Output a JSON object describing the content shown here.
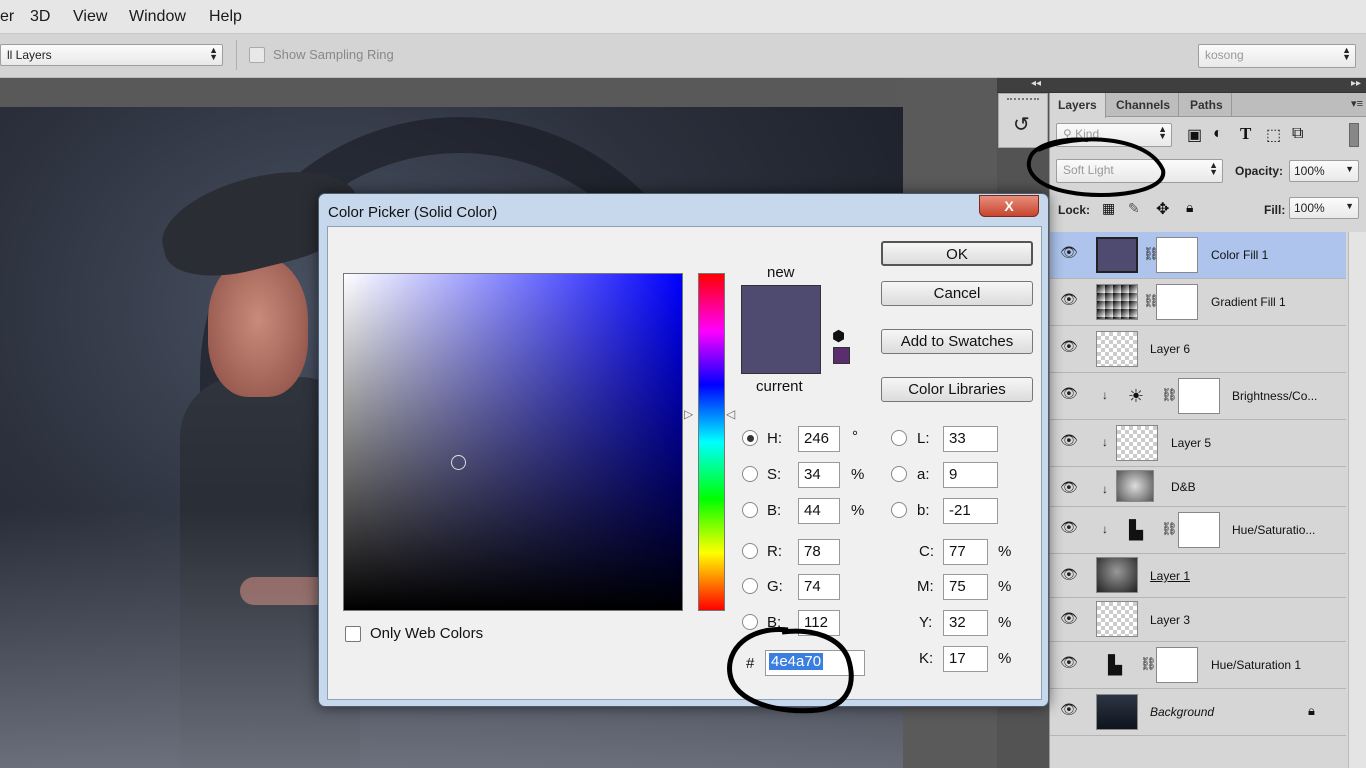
{
  "menu": {
    "items": [
      "er",
      "3D",
      "View",
      "Window",
      "Help"
    ]
  },
  "options": {
    "sample_select": "ll Layers",
    "sampling_ring_label": "Show Sampling Ring",
    "right_select": "kosong"
  },
  "colors": {
    "new": "#4e4a70",
    "current": "#4e4a70",
    "selected_layer": "#aec4ec",
    "hue_field": "#0000ff"
  },
  "dialog": {
    "title": "Color Picker (Solid Color)",
    "close": "X",
    "new_label": "new",
    "current_label": "current",
    "buttons": {
      "ok": "OK",
      "cancel": "Cancel",
      "add_swatches": "Add to Swatches",
      "color_libraries": "Color Libraries"
    },
    "only_web_colors": "Only Web Colors",
    "hsb": {
      "h_label": "H:",
      "h": "246",
      "h_unit": "°",
      "s_label": "S:",
      "s": "34",
      "s_unit": "%",
      "b_label": "B:",
      "b": "44",
      "b_unit": "%"
    },
    "rgb": {
      "r_label": "R:",
      "r": "78",
      "g_label": "G:",
      "g": "74",
      "b_label": "B:",
      "b": "112"
    },
    "lab": {
      "l_label": "L:",
      "l": "33",
      "a_label": "a:",
      "a": "9",
      "b_label": "b:",
      "b": "-21"
    },
    "cmyk": {
      "c_label": "C:",
      "c": "77",
      "m_label": "M:",
      "m": "75",
      "y_label": "Y:",
      "y": "32",
      "k_label": "K:",
      "k": "17",
      "unit": "%"
    },
    "hex_label": "#",
    "hex": "4e4a70"
  },
  "layers_panel": {
    "tabs": [
      "Layers",
      "Channels",
      "Paths"
    ],
    "kind_placeholder": "Kind",
    "blend_mode": "Soft Light",
    "opacity_label": "Opacity:",
    "opacity": "100%",
    "lock_label": "Lock:",
    "fill_label": "Fill:",
    "fill": "100%",
    "layers": [
      {
        "name": "Color Fill 1",
        "selected": true
      },
      {
        "name": "Gradient Fill 1"
      },
      {
        "name": "Layer 6"
      },
      {
        "name": "Brightness/Co..."
      },
      {
        "name": "Layer 5"
      },
      {
        "name": "D&B"
      },
      {
        "name": "Hue/Saturatio..."
      },
      {
        "name": "Layer 1"
      },
      {
        "name": "Layer 3"
      },
      {
        "name": "Hue/Saturation 1"
      },
      {
        "name": "Background"
      }
    ]
  }
}
